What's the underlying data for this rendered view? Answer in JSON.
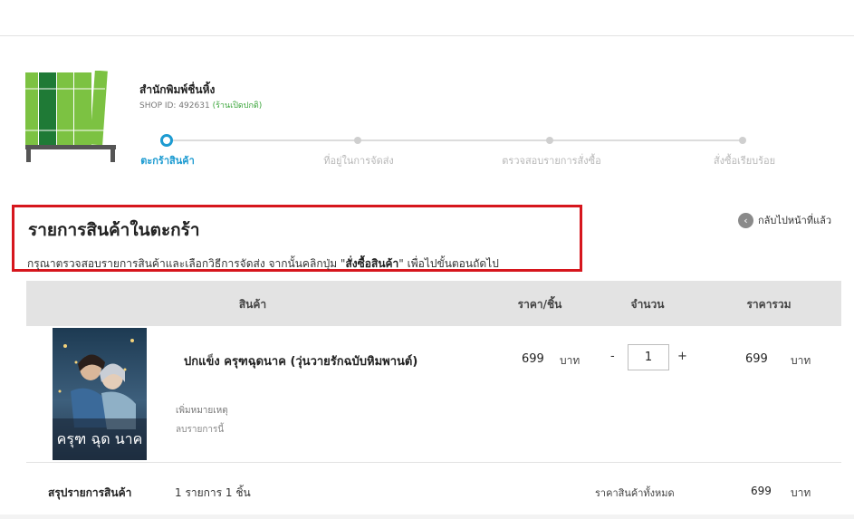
{
  "shop": {
    "name": "สำนักพิมพ์ชื่นหิ้ง",
    "id_label": "SHOP ID: 492631",
    "status": "(ร้านเปิดปกติ)"
  },
  "steps": [
    {
      "label": "ตะกร้าสินค้า",
      "active": true
    },
    {
      "label": "ที่อยู่ในการจัดส่ง",
      "active": false
    },
    {
      "label": "ตรวจสอบรายการสั่งซื้อ",
      "active": false
    },
    {
      "label": "สั่งซื้อเรียบร้อย",
      "active": false
    }
  ],
  "page": {
    "title": "รายการสินค้าในตะกร้า",
    "subtitle_before": "กรุณาตรวจสอบรายการสินค้าและเลือกวิธีการจัดส่ง จากนั้นคลิกปุ่ม \"",
    "subtitle_bold": "สั่งซื้อสินค้า",
    "subtitle_after": "\" เพื่อไปขั้นตอนถัดไป",
    "back_label": "กลับไปหน้าที่แล้ว"
  },
  "table": {
    "headers": {
      "product": "สินค้า",
      "price_per_unit": "ราคา/ชิ้น",
      "quantity": "จำนวน",
      "total": "ราคารวม"
    },
    "item": {
      "name": "ปกแข็ง ครุฑฉุดนาค (วุ่นวายรักฉบับหิมพานต์)",
      "cover_title": "ครุฑ ฉุด นาค",
      "add_note": "เพิ่มหมายเหตุ",
      "remove": "ลบรายการนี้",
      "price": "699",
      "price_unit": "บาท",
      "minus": "-",
      "quantity": "1",
      "plus": "+",
      "total": "699",
      "total_unit": "บาท"
    }
  },
  "summary": {
    "label": "สรุปรายการสินค้า",
    "count": "1 รายการ 1 ชิ้น",
    "all_label": "ราคาสินค้าทั้งหมด",
    "total": "699",
    "unit": "บาท"
  },
  "colors": {
    "accent": "#1d9bd1",
    "highlight_border": "#d6161d",
    "open_status": "#3aa53a",
    "logo_green": "#7cc242",
    "logo_dark_green": "#1f7a36"
  }
}
